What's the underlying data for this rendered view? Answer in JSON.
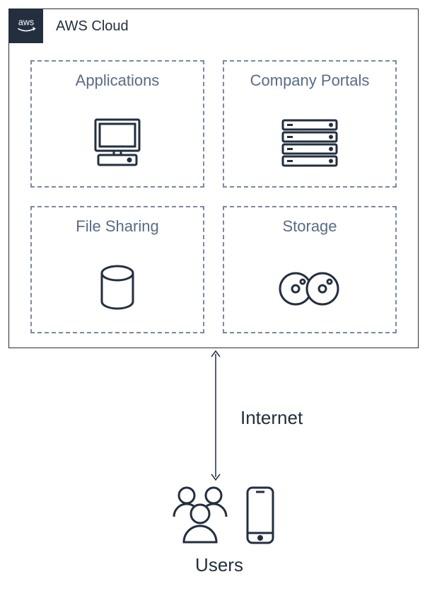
{
  "cloud": {
    "badge": "aws",
    "title": "AWS Cloud",
    "boxes": [
      {
        "label": "Applications",
        "icon": "computer-icon"
      },
      {
        "label": "Company Portals",
        "icon": "servers-icon"
      },
      {
        "label": "File Sharing",
        "icon": "cylinder-icon"
      },
      {
        "label": "Storage",
        "icon": "discs-icon"
      }
    ]
  },
  "connection": {
    "label": "Internet"
  },
  "users": {
    "label": "Users"
  }
}
